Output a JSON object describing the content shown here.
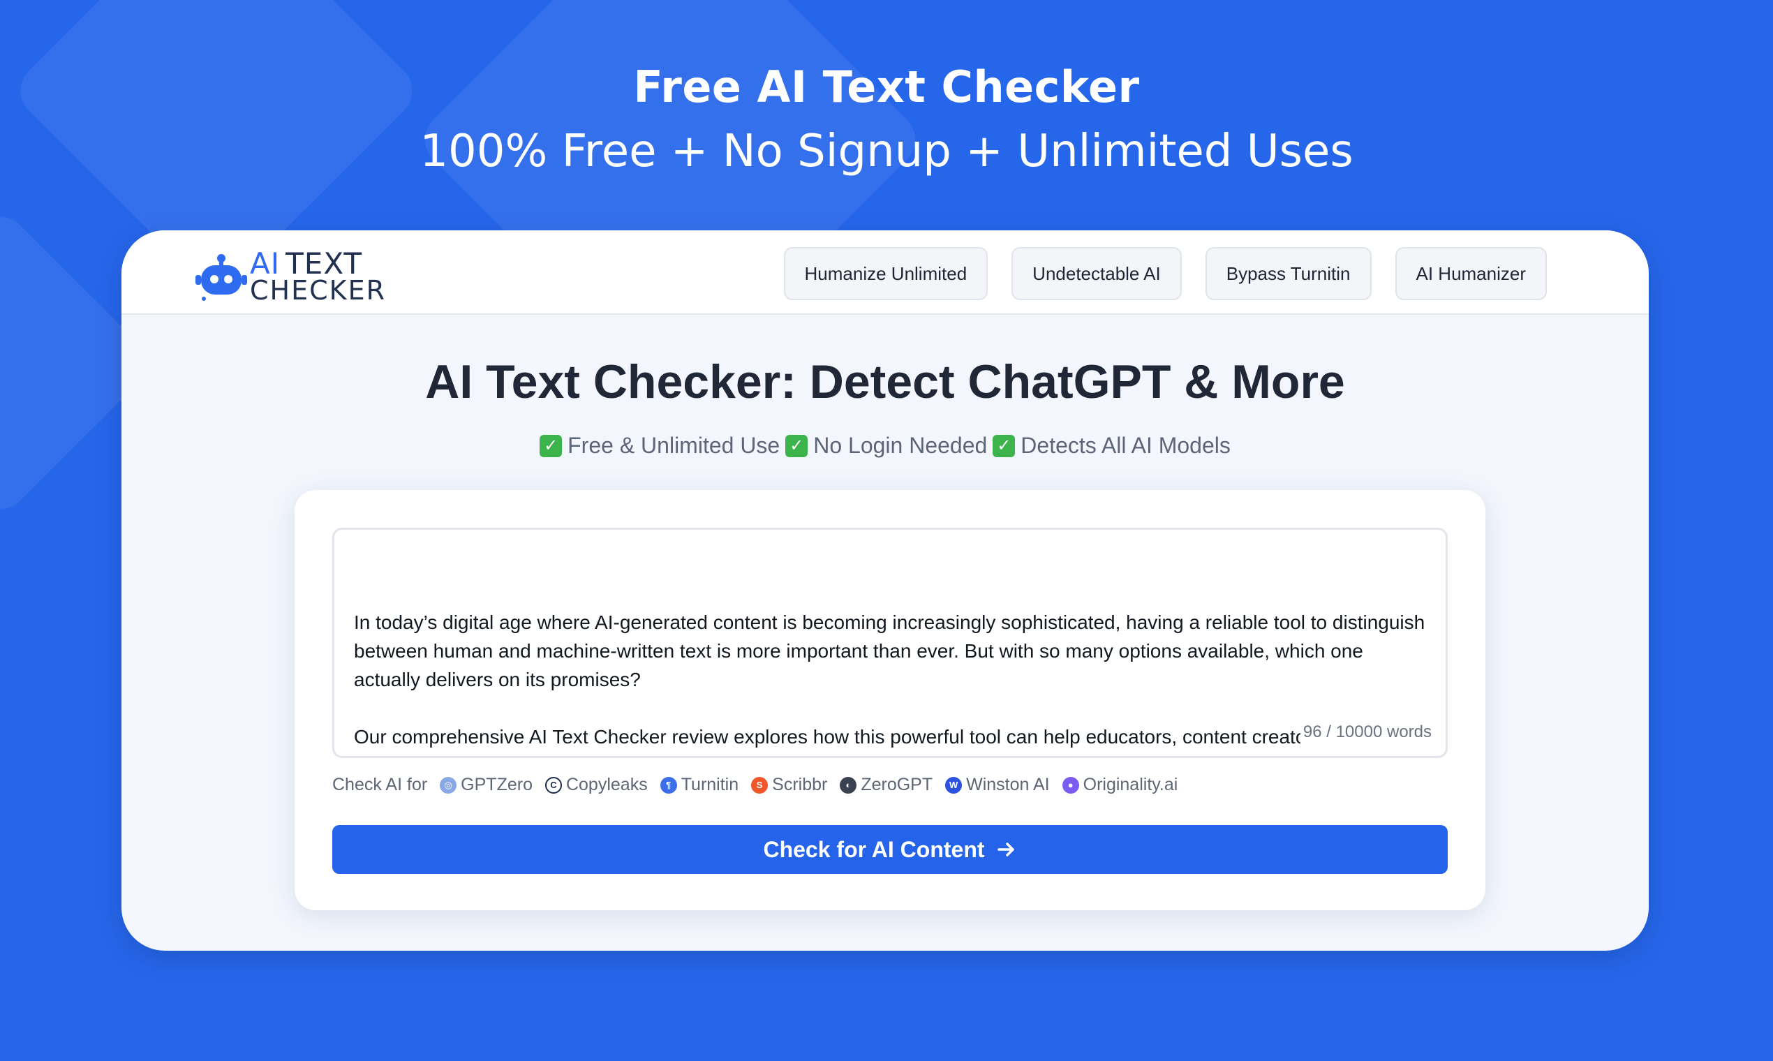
{
  "hero": {
    "title": "Free AI Text Checker",
    "subtitle": "100% Free + No Signup + Unlimited Uses"
  },
  "logo": {
    "line1_ai": "AI",
    "line1_text": "TEXT",
    "line2": "CHECKER"
  },
  "nav": {
    "items": [
      {
        "label": "Humanize Unlimited"
      },
      {
        "label": "Undetectable AI"
      },
      {
        "label": "Bypass Turnitin"
      },
      {
        "label": "AI Humanizer"
      }
    ]
  },
  "page": {
    "title": "AI Text Checker: Detect ChatGPT & More",
    "features": [
      {
        "label": "Free & Unlimited Use"
      },
      {
        "label": "No Login Needed"
      },
      {
        "label": "Detects All AI Models"
      }
    ]
  },
  "editor": {
    "value": "In today’s digital age where AI-generated content is becoming increasingly sophisticated, having a reliable tool to distinguish between human and machine-written text is more important than ever. But with so many options available, which one actually delivers on its promises?\n\nOur comprehensive AI Text Checker review explores how this powerful tool can help educators, content creators, and businesses verify the authenticity of written work. Unlike many competitors that overpromise and underdeliver, this",
    "word_count": "96 / 10000 words"
  },
  "detectors": {
    "prefix": "Check AI for",
    "items": [
      {
        "label": "GPTZero",
        "icon": "gptzero-icon",
        "color": "#8aa8e6"
      },
      {
        "label": "Copyleaks",
        "icon": "copyleaks-icon",
        "color": "#1c2a4a"
      },
      {
        "label": "Turnitin",
        "icon": "turnitin-icon",
        "color": "#3b6ee8"
      },
      {
        "label": "Scribbr",
        "icon": "scribbr-icon",
        "color": "#f0572b"
      },
      {
        "label": "ZeroGPT",
        "icon": "zerogpt-icon",
        "color": "#3a4252"
      },
      {
        "label": "Winston AI",
        "icon": "winston-icon",
        "color": "#2e52e0"
      },
      {
        "label": "Originality.ai",
        "icon": "originality-icon",
        "color": "#7a5cf0"
      }
    ]
  },
  "submit": {
    "label": "Check for AI Content"
  },
  "colors": {
    "background": "#2666eb",
    "accent": "#2563eb",
    "check_green": "#3cb44b"
  }
}
